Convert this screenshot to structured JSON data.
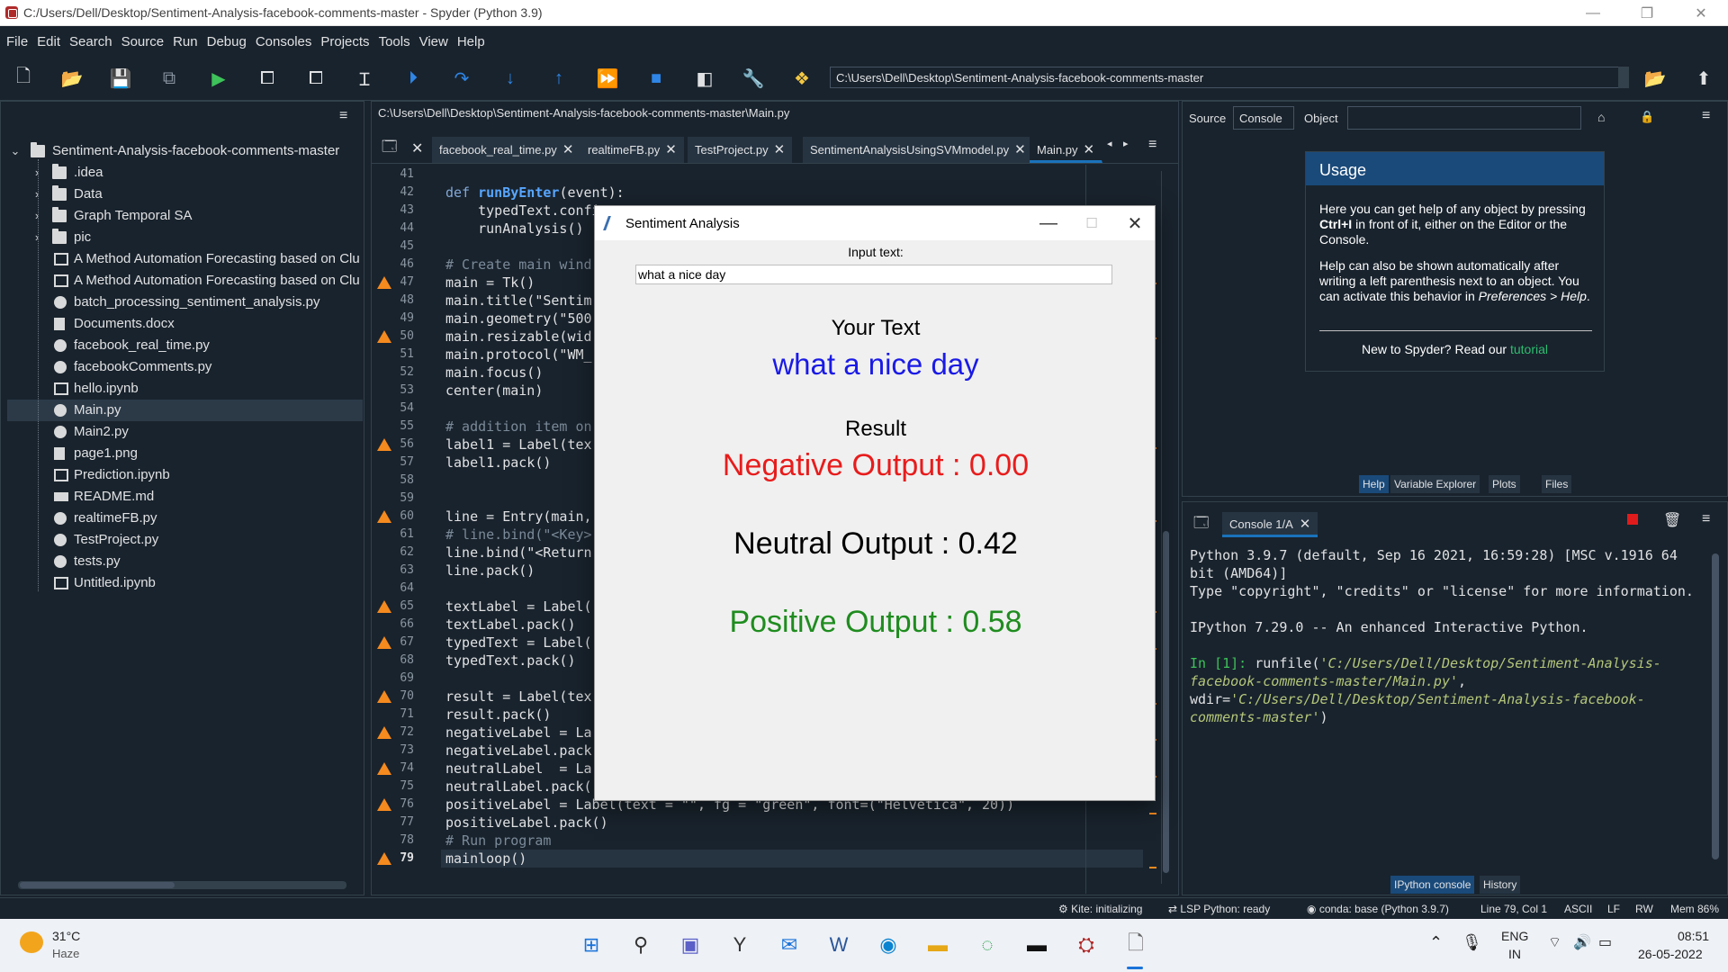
{
  "window": {
    "title": "C:/Users/Dell/Desktop/Sentiment-Analysis-facebook-comments-master - Spyder (Python 3.9)"
  },
  "menu": [
    "File",
    "Edit",
    "Search",
    "Source",
    "Run",
    "Debug",
    "Consoles",
    "Projects",
    "Tools",
    "View",
    "Help"
  ],
  "toolbar": {
    "path": "C:\\Users\\Dell\\Desktop\\Sentiment-Analysis-facebook-comments-master"
  },
  "filetree": {
    "root": "Sentiment-Analysis-facebook-comments-master",
    "folders": [
      ".idea",
      "Data",
      "Graph Temporal SA",
      "pic"
    ],
    "files": [
      {
        "name": "A Method Automation Forecasting based on Clu",
        "type": "nb"
      },
      {
        "name": "A Method Automation Forecasting based on Clu",
        "type": "nb"
      },
      {
        "name": "batch_processing_sentiment_analysis.py",
        "type": "py"
      },
      {
        "name": "Documents.docx",
        "type": "doc"
      },
      {
        "name": "facebook_real_time.py",
        "type": "py"
      },
      {
        "name": "facebookComments.py",
        "type": "py"
      },
      {
        "name": "hello.ipynb",
        "type": "nb"
      },
      {
        "name": "Main.py",
        "type": "py",
        "selected": true
      },
      {
        "name": "Main2.py",
        "type": "py"
      },
      {
        "name": "page1.png",
        "type": "doc"
      },
      {
        "name": "Prediction.ipynb",
        "type": "nb"
      },
      {
        "name": "README.md",
        "type": "md"
      },
      {
        "name": "realtimeFB.py",
        "type": "py"
      },
      {
        "name": "TestProject.py",
        "type": "py"
      },
      {
        "name": "tests.py",
        "type": "py"
      },
      {
        "name": "Untitled.ipynb",
        "type": "nb"
      }
    ]
  },
  "editor": {
    "path": "C:\\Users\\Dell\\Desktop\\Sentiment-Analysis-facebook-comments-master\\Main.py",
    "tabs": [
      "facebook_real_time.py",
      "realtimeFB.py",
      "TestProject.py",
      "SentimentAnalysisUsingSVMmodel.py",
      "Main.py"
    ],
    "lines": [
      {
        "n": "41",
        "t": ""
      },
      {
        "n": "42",
        "t": "def runByEnter(event):",
        "k": "def"
      },
      {
        "n": "43",
        "t": "    typedText.confi"
      },
      {
        "n": "44",
        "t": "    runAnalysis()"
      },
      {
        "n": "45",
        "t": ""
      },
      {
        "n": "46",
        "t": "# Create main wind",
        "k": "cm"
      },
      {
        "n": "47",
        "t": "main = Tk()",
        "w": true
      },
      {
        "n": "48",
        "t": "main.title(\"Sentim",
        "s": true
      },
      {
        "n": "49",
        "t": "main.geometry(\"500",
        "s": true
      },
      {
        "n": "50",
        "t": "main.resizable(wid",
        "w": true
      },
      {
        "n": "51",
        "t": "main.protocol(\"WM_",
        "s": true
      },
      {
        "n": "52",
        "t": "main.focus()"
      },
      {
        "n": "53",
        "t": "center(main)"
      },
      {
        "n": "54",
        "t": ""
      },
      {
        "n": "55",
        "t": "# addition item on",
        "k": "cm"
      },
      {
        "n": "56",
        "t": "label1 = Label(tex",
        "w": true
      },
      {
        "n": "57",
        "t": "label1.pack()"
      },
      {
        "n": "58",
        "t": ""
      },
      {
        "n": "59",
        "t": ""
      },
      {
        "n": "60",
        "t": "line = Entry(main,",
        "w": true
      },
      {
        "n": "61",
        "t": "# line.bind(\"<Key>",
        "k": "cm"
      },
      {
        "n": "62",
        "t": "line.bind(\"<Return",
        "s": true
      },
      {
        "n": "63",
        "t": "line.pack()"
      },
      {
        "n": "64",
        "t": ""
      },
      {
        "n": "65",
        "t": "textLabel = Label(",
        "w": true
      },
      {
        "n": "66",
        "t": "textLabel.pack()"
      },
      {
        "n": "67",
        "t": "typedText = Label(",
        "w": true
      },
      {
        "n": "68",
        "t": "typedText.pack()"
      },
      {
        "n": "69",
        "t": ""
      },
      {
        "n": "70",
        "t": "result = Label(tex",
        "w": true
      },
      {
        "n": "71",
        "t": "result.pack()"
      },
      {
        "n": "72",
        "t": "negativeLabel = La",
        "w": true
      },
      {
        "n": "73",
        "t": "negativeLabel.pack"
      },
      {
        "n": "74",
        "t": "neutralLabel  = La",
        "w": true
      },
      {
        "n": "75",
        "t": "neutralLabel.pack("
      },
      {
        "n": "76",
        "t": "positiveLabel = Label(text = \"\", fg = \"green\", font=(\"Helvetica\", 20))",
        "w": true
      },
      {
        "n": "77",
        "t": "positiveLabel.pack()"
      },
      {
        "n": "78",
        "t": "# Run program",
        "k": "cm"
      },
      {
        "n": "79",
        "t": "mainloop()",
        "w": true
      }
    ]
  },
  "tk": {
    "title": "Sentiment Analysis",
    "input_label": "Input text:",
    "input_value": "what a nice  day",
    "your_text": "Your Text",
    "typed": "what a nice  day",
    "result": "Result",
    "negative": "Negative Output : 0.00",
    "neutral": "Neutral Output : 0.42",
    "positive": "Positive Output : 0.58",
    "colors": {
      "negative": "#e81c1c",
      "neutral": "#000000",
      "positive": "#1f8c1f",
      "typed": "#1a1ae6"
    }
  },
  "help": {
    "source_label": "Source",
    "source_value": "Console",
    "object_label": "Object",
    "usage_title": "Usage",
    "para1_a": "Here you can get help of any object by pressing ",
    "para1_b": "Ctrl+I",
    "para1_c": " in front of it, either on the Editor or the Console.",
    "para2_a": "Help can also be shown automatically after writing a left parenthesis next to an object. You can activate this behavior in ",
    "para2_b": "Preferences > Help",
    "para2_c": ".",
    "new_to": "New to Spyder? Read our ",
    "tutorial": "tutorial",
    "tabs": [
      "Help",
      "Variable Explorer",
      "Plots",
      "Files"
    ]
  },
  "console": {
    "tab": "Console 1/A",
    "line1": "Python 3.9.7 (default, Sep 16 2021, 16:59:28) [MSC v.1916 64 bit (AMD64)]",
    "line2": "Type \"copyright\", \"credits\" or \"license\" for more information.",
    "line3": "IPython 7.29.0 -- An enhanced Interactive Python.",
    "prompt": "In [1]:",
    "cmd_a": " runfile(",
    "cmd_b": "'C:/Users/Dell/Desktop/Sentiment-Analysis-facebook-comments-master/Main.py'",
    "cmd_c": ", wdir=",
    "cmd_d": "'C:/Users/Dell/Desktop/Sentiment-Analysis-facebook-comments-master'",
    "cmd_e": ")",
    "tabs": [
      "IPython console",
      "History"
    ]
  },
  "status": {
    "kite": "Kite: initializing",
    "lsp": "LSP Python: ready",
    "conda": "conda: base (Python 3.9.7)",
    "pos": "Line 79, Col 1",
    "enc": "ASCII",
    "eol": "LF",
    "rw": "RW",
    "mem": "Mem 86%"
  },
  "taskbar": {
    "temp": "31°C",
    "weather": "Haze",
    "lang1": "ENG",
    "lang2": "IN",
    "time": "08:51",
    "date": "26-05-2022"
  }
}
